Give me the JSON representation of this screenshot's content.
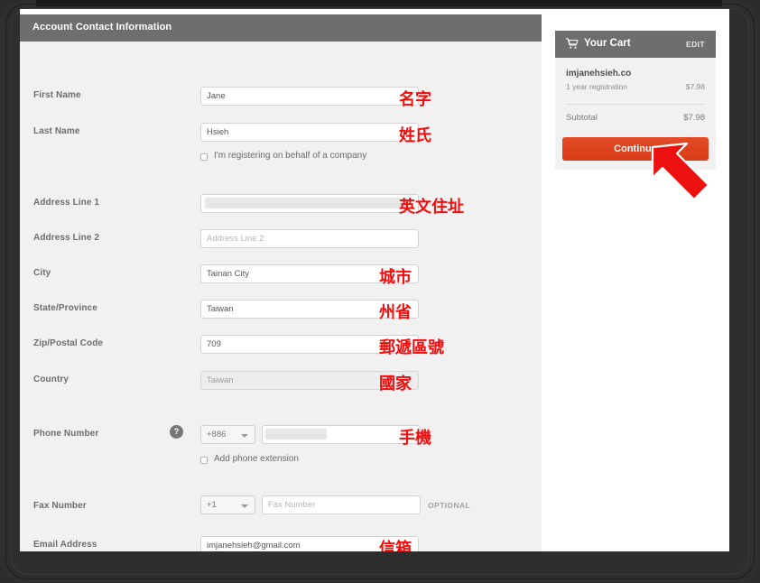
{
  "form": {
    "header_title": "Account Contact Information",
    "fields": [
      {
        "label": "First Name",
        "value": "Jane",
        "annot": "名字",
        "state": "filled"
      },
      {
        "label": "Last Name",
        "value": "Hsieh",
        "annot": "姓氏",
        "state": "filled"
      },
      {
        "label": "Address Line 1",
        "value": "",
        "annot": "英文住址",
        "state": "redacted"
      },
      {
        "label": "Address Line 2",
        "value": "Address Line 2",
        "annot": "",
        "state": "placeholder"
      },
      {
        "label": "City",
        "value": "Tainan City",
        "annot": "城市",
        "state": "filled"
      },
      {
        "label": "State/Province",
        "value": "Taiwan",
        "annot": "州省",
        "state": "filled"
      },
      {
        "label": "Zip/Postal Code",
        "value": "709",
        "annot": "郵遞區號",
        "state": "filled"
      },
      {
        "label": "Country",
        "value": "Taiwan",
        "annot": "國家",
        "state": "disabled"
      },
      {
        "label": "Phone Number",
        "value": "",
        "annot": "手機",
        "state": "redacted"
      },
      {
        "label": "Fax Number",
        "value": "Fax Number",
        "annot": "",
        "state": "placeholder"
      },
      {
        "label": "Email Address",
        "value": "imjanehsieh@gmail.com",
        "annot": "信箱",
        "state": "filled"
      }
    ],
    "company_checkbox_label": "I'm registering on behalf of a company",
    "phone_extension_checkbox_label": "Add phone extension",
    "phone_help_icon": "?",
    "phone_country_code": "+886",
    "fax_country_code": "+1",
    "fax_optional_tag": "OPTIONAL"
  },
  "cart": {
    "icon": "shopping-cart-icon",
    "title": "Your Cart",
    "edit_label": "EDIT",
    "item_name": "imjanehsieh.co",
    "item_desc": "1 year registration",
    "item_price": "$7.98",
    "subtotal_label": "Subtotal",
    "subtotal_value": "$7.98",
    "continue_label": "Continue"
  },
  "colors": {
    "header_gray": "#6e6e6e",
    "panel_gray": "#f1f1f1",
    "accent_red": "#e0411f",
    "annotation_red": "#f20d0d",
    "frame_dark": "#2e2e2e"
  }
}
